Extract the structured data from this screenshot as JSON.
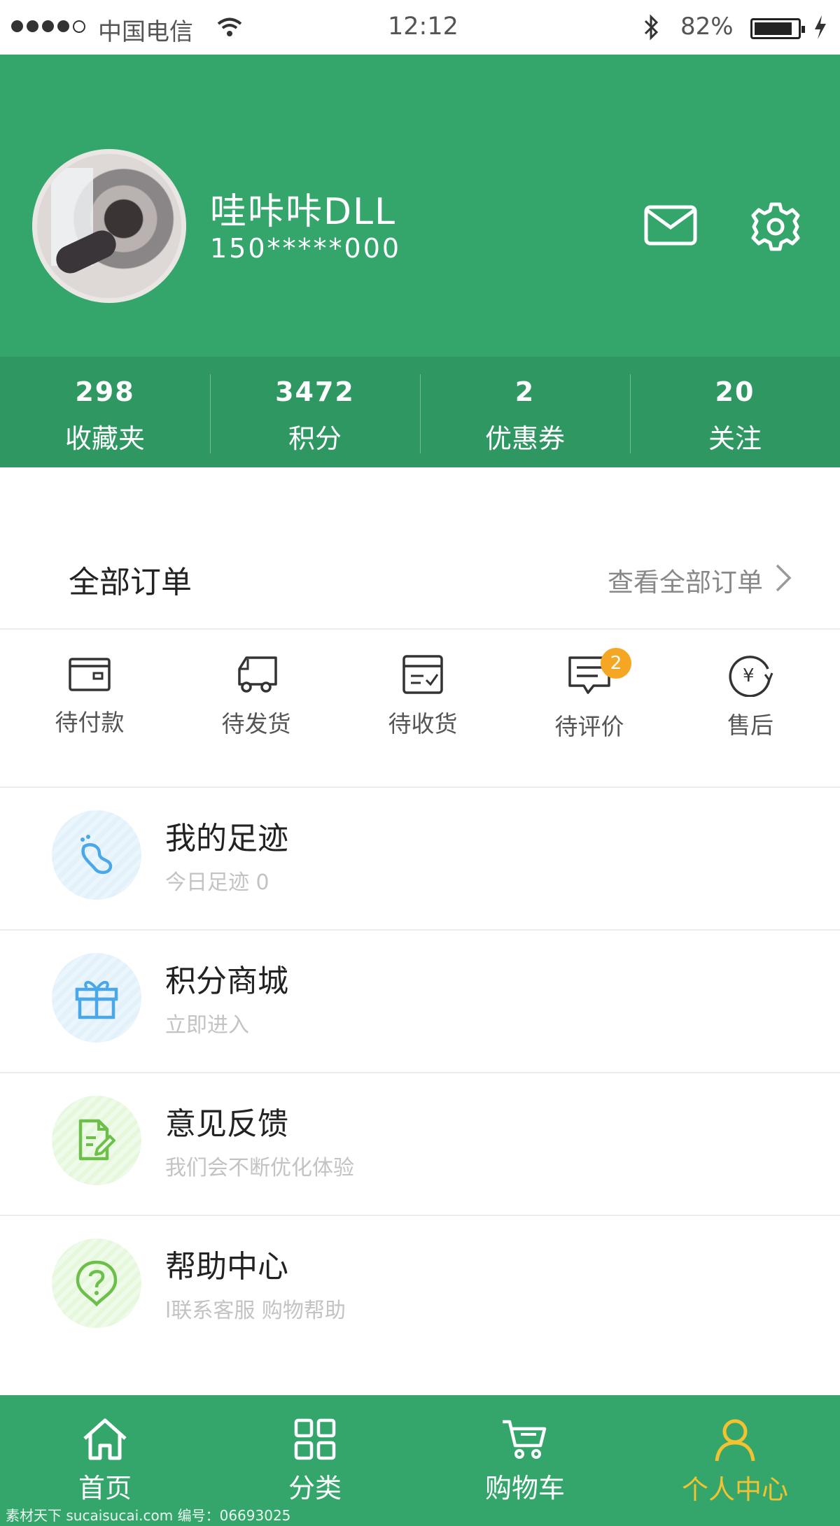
{
  "status_bar": {
    "carrier": "中国电信",
    "time": "12:12",
    "battery": "82%"
  },
  "profile": {
    "name": "哇咔咔DLL",
    "phone": "150*****000",
    "message_icon": "envelope-icon",
    "settings_icon": "gear-icon"
  },
  "stats": [
    {
      "value": "298",
      "label": "收藏夹"
    },
    {
      "value": "3472",
      "label": "积分"
    },
    {
      "value": "2",
      "label": "优惠券"
    },
    {
      "value": "20",
      "label": "关注"
    }
  ],
  "orders": {
    "title": "全部订单",
    "view_all": "查看全部订单",
    "items": [
      {
        "label": "待付款",
        "icon": "wallet-icon"
      },
      {
        "label": "待发货",
        "icon": "truck-icon"
      },
      {
        "label": "待收货",
        "icon": "package-icon"
      },
      {
        "label": "待评价",
        "icon": "comment-icon",
        "badge": "2"
      },
      {
        "label": "售后",
        "icon": "refund-icon"
      }
    ]
  },
  "list": [
    {
      "title": "我的足迹",
      "subtitle": "今日足迹 0",
      "icon": "footprint-icon",
      "color": "#4aa8e8"
    },
    {
      "title": "积分商城",
      "subtitle": "立即进入",
      "icon": "gift-icon",
      "color": "#4aa8e8"
    },
    {
      "title": "意见反馈",
      "subtitle": "我们会不断优化体验",
      "icon": "feedback-icon",
      "color": "#6cc04a"
    },
    {
      "title": "帮助中心",
      "subtitle": "l联系客服 购物帮助",
      "icon": "help-icon",
      "color": "#6cc04a"
    }
  ],
  "tabbar": [
    {
      "label": "首页",
      "icon": "home-icon"
    },
    {
      "label": "分类",
      "icon": "grid-icon"
    },
    {
      "label": "购物车",
      "icon": "cart-icon"
    },
    {
      "label": "个人中心",
      "icon": "user-icon",
      "active": true
    }
  ],
  "colors": {
    "primary": "#34a66c",
    "stats_bg": "#2f9862",
    "active_tab": "#f2c230",
    "badge": "#f5a623"
  },
  "watermark": "素材天下 sucaisucai.com  编号：06693025"
}
